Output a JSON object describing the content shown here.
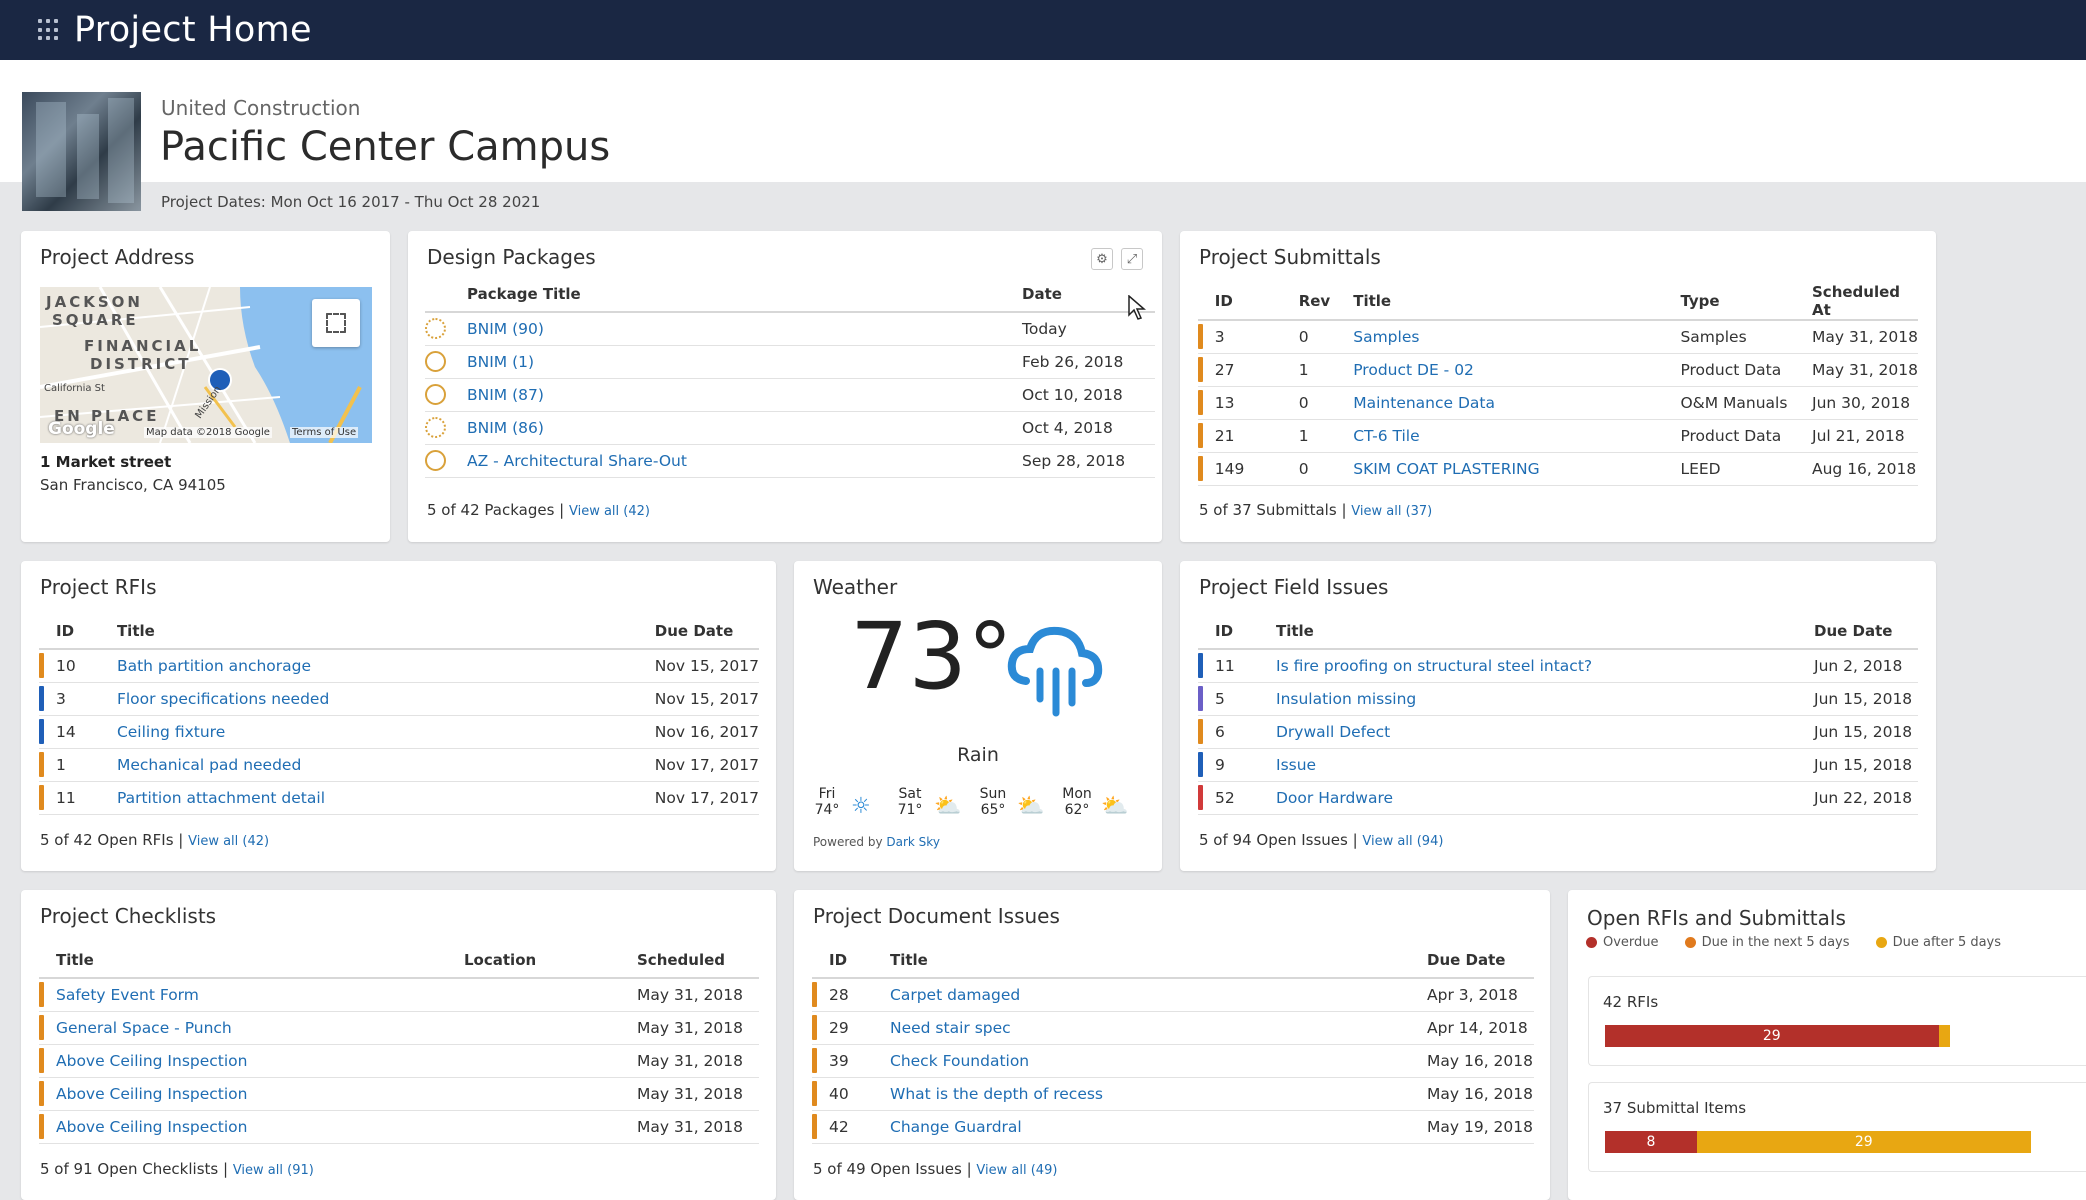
{
  "app": {
    "title": "Project Home"
  },
  "project": {
    "company": "United Construction",
    "name": "Pacific Center Campus",
    "dates": "Project Dates: Mon Oct 16 2017 - Thu Oct 28 2021"
  },
  "address": {
    "title": "Project Address",
    "line1": "1 Market street",
    "line2": "San Francisco, CA 94105",
    "map_labels": {
      "l1": "JACKSON",
      "l2": "SQUARE",
      "l3": "FINANCIAL",
      "l4": "DISTRICT",
      "l5": "California St",
      "l6": "EN PLACE",
      "l7": "Mission",
      "logo": "Google",
      "credit": "Map data ©2018 Google",
      "terms": "Terms of Use"
    },
    "fullscreen_icon": "fullscreen-icon"
  },
  "design_packages": {
    "title": "Design Packages",
    "headers": {
      "title": "Package Title",
      "date": "Date"
    },
    "rows": [
      {
        "title": "BNIM (90)",
        "date": "Today",
        "status": "dashed"
      },
      {
        "title": "BNIM (1)",
        "date": "Feb 26, 2018",
        "status": "solid"
      },
      {
        "title": "BNIM (87)",
        "date": "Oct 10, 2018",
        "status": "solid"
      },
      {
        "title": "BNIM (86)",
        "date": "Oct 4, 2018",
        "status": "dashed"
      },
      {
        "title": "AZ - Architectural Share-Out",
        "date": "Sep 28, 2018",
        "status": "solid"
      }
    ],
    "footer": "5 of 42 Packages",
    "view_all": "View all (42)"
  },
  "submittals": {
    "title": "Project Submittals",
    "headers": {
      "id": "ID",
      "rev": "Rev",
      "title": "Title",
      "type": "Type",
      "scheduled": "Scheduled At"
    },
    "rows": [
      {
        "id": "3",
        "rev": "0",
        "title": "Samples",
        "type": "Samples",
        "scheduled": "May 31, 2018",
        "color": "#e08a1e"
      },
      {
        "id": "27",
        "rev": "1",
        "title": "Product DE - 02",
        "type": "Product Data",
        "scheduled": "May 31, 2018",
        "color": "#e08a1e"
      },
      {
        "id": "13",
        "rev": "0",
        "title": "Maintenance Data",
        "type": "O&M Manuals",
        "scheduled": "Jun 30, 2018",
        "color": "#e08a1e"
      },
      {
        "id": "21",
        "rev": "1",
        "title": "CT-6 Tile",
        "type": "Product Data",
        "scheduled": "Jul 21, 2018",
        "color": "#e08a1e"
      },
      {
        "id": "149",
        "rev": "0",
        "title": "SKIM COAT PLASTERING",
        "type": "LEED",
        "scheduled": "Aug 16, 2018",
        "color": "#e08a1e"
      }
    ],
    "footer": "5 of 37 Submittals",
    "view_all": "View all (37)"
  },
  "rfis": {
    "title": "Project RFIs",
    "headers": {
      "id": "ID",
      "title": "Title",
      "due": "Due Date"
    },
    "rows": [
      {
        "id": "10",
        "title": "Bath partition anchorage",
        "due": "Nov 15, 2017",
        "color": "#e08a1e"
      },
      {
        "id": "3",
        "title": "Floor specifications needed",
        "due": "Nov 15, 2017",
        "color": "#1f5fb8"
      },
      {
        "id": "14",
        "title": "Ceiling fixture",
        "due": "Nov 16, 2017",
        "color": "#1f5fb8"
      },
      {
        "id": "1",
        "title": "Mechanical pad needed",
        "due": "Nov 17, 2017",
        "color": "#e08a1e"
      },
      {
        "id": "11",
        "title": "Partition attachment detail",
        "due": "Nov 17, 2017",
        "color": "#e08a1e"
      }
    ],
    "footer": "5 of 42 Open RFIs",
    "view_all": "View all (42)"
  },
  "weather": {
    "title": "Weather",
    "temp": "73°",
    "condition": "Rain",
    "forecast": [
      {
        "day": "Fri",
        "temp": "74°",
        "icon": "sun-icon"
      },
      {
        "day": "Sat",
        "temp": "71°",
        "icon": "partly-cloudy-icon"
      },
      {
        "day": "Sun",
        "temp": "65°",
        "icon": "partly-cloudy-icon"
      },
      {
        "day": "Mon",
        "temp": "62°",
        "icon": "partly-cloudy-icon"
      }
    ],
    "powered": "Powered by",
    "powered_link": "Dark Sky"
  },
  "field_issues": {
    "title": "Project Field Issues",
    "headers": {
      "id": "ID",
      "title": "Title",
      "due": "Due Date"
    },
    "rows": [
      {
        "id": "11",
        "title": "Is fire proofing on structural steel intact?",
        "due": "Jun 2, 2018",
        "color": "#1f5fb8"
      },
      {
        "id": "5",
        "title": "Insulation missing",
        "due": "Jun 15, 2018",
        "color": "#6b5fc7"
      },
      {
        "id": "6",
        "title": "Drywall Defect",
        "due": "Jun 15, 2018",
        "color": "#e08a1e"
      },
      {
        "id": "9",
        "title": "Issue",
        "due": "Jun 15, 2018",
        "color": "#1f5fb8"
      },
      {
        "id": "52",
        "title": "Door Hardware",
        "due": "Jun 22, 2018",
        "color": "#d13a3a"
      }
    ],
    "footer": "5 of 94 Open Issues",
    "view_all": "View all (94)"
  },
  "checklists": {
    "title": "Project Checklists",
    "headers": {
      "title": "Title",
      "location": "Location",
      "scheduled": "Scheduled"
    },
    "rows": [
      {
        "title": "Safety Event Form",
        "location": "",
        "scheduled": "May 31, 2018",
        "color": "#e08a1e"
      },
      {
        "title": "General Space - Punch",
        "location": "",
        "scheduled": "May 31, 2018",
        "color": "#e08a1e"
      },
      {
        "title": "Above Ceiling Inspection",
        "location": "",
        "scheduled": "May 31, 2018",
        "color": "#e08a1e"
      },
      {
        "title": "Above Ceiling Inspection",
        "location": "",
        "scheduled": "May 31, 2018",
        "color": "#e08a1e"
      },
      {
        "title": "Above Ceiling Inspection",
        "location": "",
        "scheduled": "May 31, 2018",
        "color": "#e08a1e"
      }
    ],
    "footer": "5 of 91 Open Checklists",
    "view_all": "View all (91)"
  },
  "doc_issues": {
    "title": "Project Document Issues",
    "headers": {
      "id": "ID",
      "title": "Title",
      "due": "Due Date"
    },
    "rows": [
      {
        "id": "28",
        "title": "Carpet damaged",
        "due": "Apr 3, 2018",
        "color": "#e08a1e"
      },
      {
        "id": "29",
        "title": "Need stair spec",
        "due": "Apr 14, 2018",
        "color": "#e08a1e"
      },
      {
        "id": "39",
        "title": "Check Foundation",
        "due": "May 16, 2018",
        "color": "#e08a1e"
      },
      {
        "id": "40",
        "title": "What is the depth of recess",
        "due": "May 16, 2018",
        "color": "#e08a1e"
      },
      {
        "id": "42",
        "title": "Change Guardral",
        "due": "May 19, 2018",
        "color": "#e08a1e"
      }
    ],
    "footer": "5 of 49 Open Issues",
    "view_all": "View all (49)"
  },
  "open_items": {
    "title": "Open RFIs and Submittals",
    "legend": [
      {
        "label": "Overdue",
        "color": "#b3302a"
      },
      {
        "label": "Due in the next 5 days",
        "color": "#e07a1e"
      },
      {
        "label": "Due after 5 days",
        "color": "#e8a712"
      }
    ],
    "groups": [
      {
        "label": "42 RFIs",
        "segments": [
          {
            "value": 29,
            "label": "29",
            "color": "#b3302a"
          },
          {
            "value": 1,
            "label": "",
            "color": "#e8a712"
          }
        ]
      },
      {
        "label": "37 Submittal Items",
        "segments": [
          {
            "value": 8,
            "label": "8",
            "color": "#b3302a"
          },
          {
            "value": 29,
            "label": "29",
            "color": "#e8a712"
          }
        ]
      }
    ]
  }
}
